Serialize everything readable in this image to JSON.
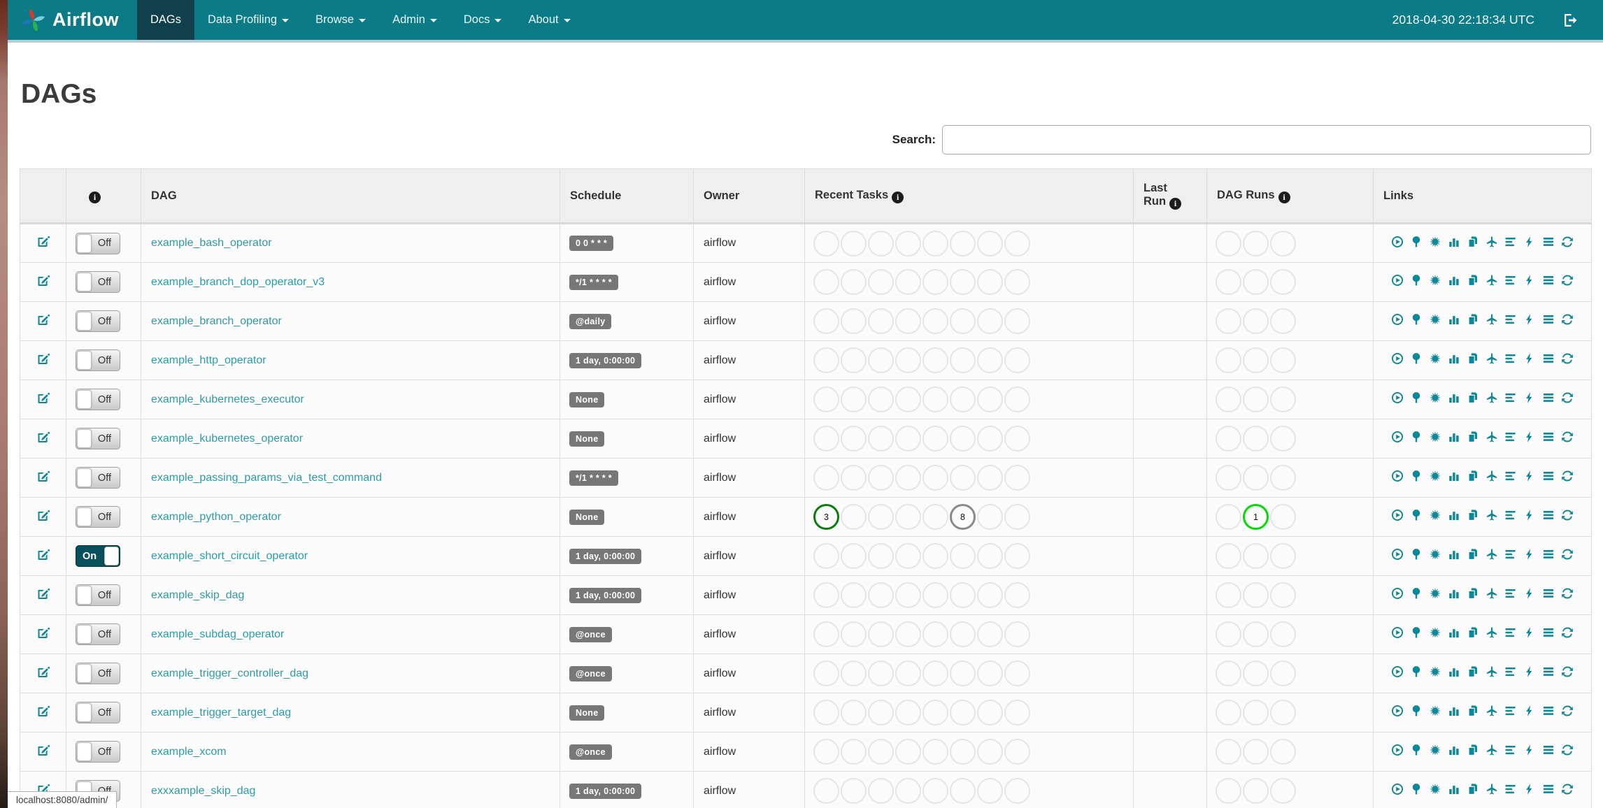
{
  "colors": {
    "navbar": "#0c7b88",
    "navbar_active": "#10404c",
    "accent_link": "#2b9dae",
    "icon_teal": "#0d879a",
    "badge_bg": "#777777",
    "toggle_on": "#07505c",
    "task_success_green": "#0b7c0b",
    "task_gray": "#8a8a8a",
    "dag_run_running_green": "#04dd04",
    "empty_circle_border": "#e5e5e5"
  },
  "navbar": {
    "brand": "Airflow",
    "items": [
      {
        "label": "DAGs",
        "caret": false,
        "active": true
      },
      {
        "label": "Data Profiling",
        "caret": true,
        "active": false
      },
      {
        "label": "Browse",
        "caret": true,
        "active": false
      },
      {
        "label": "Admin",
        "caret": true,
        "active": false
      },
      {
        "label": "Docs",
        "caret": true,
        "active": false
      },
      {
        "label": "About",
        "caret": true,
        "active": false
      }
    ],
    "clock": "2018-04-30 22:18:34 UTC"
  },
  "page": {
    "title": "DAGs",
    "search_label": "Search:",
    "search_value": "",
    "status_bar": "localhost:8080/admin/"
  },
  "table": {
    "headers": {
      "dag": "DAG",
      "schedule": "Schedule",
      "owner": "Owner",
      "recent_tasks": "Recent Tasks",
      "last_run_line1": "Last",
      "last_run_line2": "Run",
      "dag_runs": "DAG Runs",
      "links": "Links",
      "info_glyph": "i"
    },
    "recent_task_slots": 8,
    "dag_run_slots": 3,
    "link_icons": [
      {
        "name": "trigger-dag-icon",
        "glyph": "play_circle"
      },
      {
        "name": "tree-view-icon",
        "glyph": "tree"
      },
      {
        "name": "graph-view-icon",
        "glyph": "sunburst"
      },
      {
        "name": "task-duration-icon",
        "glyph": "bar_chart"
      },
      {
        "name": "task-tries-icon",
        "glyph": "copy"
      },
      {
        "name": "landing-times-icon",
        "glyph": "plane"
      },
      {
        "name": "gantt-icon",
        "glyph": "align_left"
      },
      {
        "name": "landing-bolt-icon",
        "glyph": "bolt"
      },
      {
        "name": "code-view-icon",
        "glyph": "list"
      },
      {
        "name": "refresh-icon",
        "glyph": "refresh"
      }
    ],
    "rows": [
      {
        "name": "example_bash_operator",
        "toggle": "Off",
        "enabled": false,
        "schedule": "0 0 * * *",
        "owner": "airflow",
        "recent_tasks": [
          null,
          null,
          null,
          null,
          null,
          null,
          null,
          null
        ],
        "dag_runs": [
          null,
          null,
          null
        ]
      },
      {
        "name": "example_branch_dop_operator_v3",
        "toggle": "Off",
        "enabled": false,
        "schedule": "*/1 * * * *",
        "owner": "airflow",
        "recent_tasks": [
          null,
          null,
          null,
          null,
          null,
          null,
          null,
          null
        ],
        "dag_runs": [
          null,
          null,
          null
        ]
      },
      {
        "name": "example_branch_operator",
        "toggle": "Off",
        "enabled": false,
        "schedule": "@daily",
        "owner": "airflow",
        "recent_tasks": [
          null,
          null,
          null,
          null,
          null,
          null,
          null,
          null
        ],
        "dag_runs": [
          null,
          null,
          null
        ]
      },
      {
        "name": "example_http_operator",
        "toggle": "Off",
        "enabled": false,
        "schedule": "1 day, 0:00:00",
        "owner": "airflow",
        "recent_tasks": [
          null,
          null,
          null,
          null,
          null,
          null,
          null,
          null
        ],
        "dag_runs": [
          null,
          null,
          null
        ]
      },
      {
        "name": "example_kubernetes_executor",
        "toggle": "Off",
        "enabled": false,
        "schedule": "None",
        "owner": "airflow",
        "recent_tasks": [
          null,
          null,
          null,
          null,
          null,
          null,
          null,
          null
        ],
        "dag_runs": [
          null,
          null,
          null
        ]
      },
      {
        "name": "example_kubernetes_operator",
        "toggle": "Off",
        "enabled": false,
        "schedule": "None",
        "owner": "airflow",
        "recent_tasks": [
          null,
          null,
          null,
          null,
          null,
          null,
          null,
          null
        ],
        "dag_runs": [
          null,
          null,
          null
        ]
      },
      {
        "name": "example_passing_params_via_test_command",
        "toggle": "Off",
        "enabled": false,
        "schedule": "*/1 * * * *",
        "owner": "airflow",
        "recent_tasks": [
          null,
          null,
          null,
          null,
          null,
          null,
          null,
          null
        ],
        "dag_runs": [
          null,
          null,
          null
        ]
      },
      {
        "name": "example_python_operator",
        "toggle": "Off",
        "enabled": false,
        "schedule": "None",
        "owner": "airflow",
        "recent_tasks": [
          {
            "value": 3,
            "color": "#0b7c0b"
          },
          null,
          null,
          null,
          null,
          {
            "value": 8,
            "color": "#8a8a8a"
          },
          null,
          null
        ],
        "dag_runs": [
          null,
          {
            "value": 1,
            "color": "#04dd04"
          },
          null
        ]
      },
      {
        "name": "example_short_circuit_operator",
        "toggle": "On",
        "enabled": true,
        "schedule": "1 day, 0:00:00",
        "owner": "airflow",
        "recent_tasks": [
          null,
          null,
          null,
          null,
          null,
          null,
          null,
          null
        ],
        "dag_runs": [
          null,
          null,
          null
        ]
      },
      {
        "name": "example_skip_dag",
        "toggle": "Off",
        "enabled": false,
        "schedule": "1 day, 0:00:00",
        "owner": "airflow",
        "recent_tasks": [
          null,
          null,
          null,
          null,
          null,
          null,
          null,
          null
        ],
        "dag_runs": [
          null,
          null,
          null
        ]
      },
      {
        "name": "example_subdag_operator",
        "toggle": "Off",
        "enabled": false,
        "schedule": "@once",
        "owner": "airflow",
        "recent_tasks": [
          null,
          null,
          null,
          null,
          null,
          null,
          null,
          null
        ],
        "dag_runs": [
          null,
          null,
          null
        ]
      },
      {
        "name": "example_trigger_controller_dag",
        "toggle": "Off",
        "enabled": false,
        "schedule": "@once",
        "owner": "airflow",
        "recent_tasks": [
          null,
          null,
          null,
          null,
          null,
          null,
          null,
          null
        ],
        "dag_runs": [
          null,
          null,
          null
        ]
      },
      {
        "name": "example_trigger_target_dag",
        "toggle": "Off",
        "enabled": false,
        "schedule": "None",
        "owner": "airflow",
        "recent_tasks": [
          null,
          null,
          null,
          null,
          null,
          null,
          null,
          null
        ],
        "dag_runs": [
          null,
          null,
          null
        ]
      },
      {
        "name": "example_xcom",
        "toggle": "Off",
        "enabled": false,
        "schedule": "@once",
        "owner": "airflow",
        "recent_tasks": [
          null,
          null,
          null,
          null,
          null,
          null,
          null,
          null
        ],
        "dag_runs": [
          null,
          null,
          null
        ]
      },
      {
        "name": "exxxample_skip_dag",
        "toggle": "Off",
        "enabled": false,
        "schedule": "1 day, 0:00:00",
        "owner": "airflow",
        "recent_tasks": [
          null,
          null,
          null,
          null,
          null,
          null,
          null,
          null
        ],
        "dag_runs": [
          null,
          null,
          null
        ]
      }
    ]
  }
}
